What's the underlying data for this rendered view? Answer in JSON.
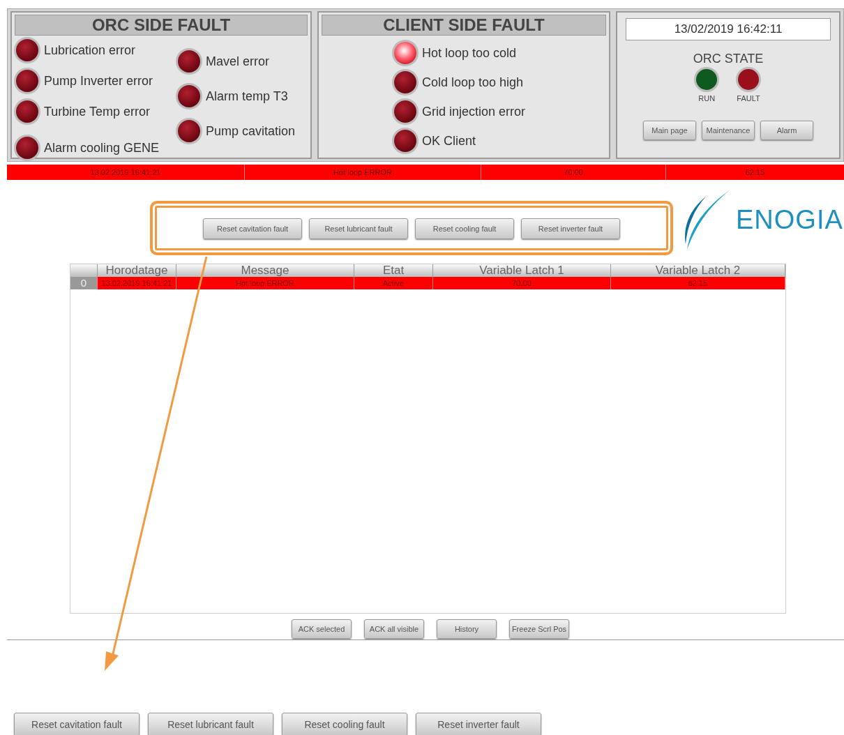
{
  "orc_side_fault": {
    "title": "ORC SIDE FAULT",
    "columns": [
      [
        {
          "label": "Lubrication error",
          "on": false
        },
        {
          "label": "Pump Inverter error",
          "on": false
        },
        {
          "label": "Turbine Temp error",
          "on": false
        },
        {
          "label": "Alarm cooling GENE",
          "on": false
        }
      ],
      [
        {
          "label": "Mavel error",
          "on": false
        },
        {
          "label": "Alarm temp T3",
          "on": false
        },
        {
          "label": "Pump cavitation",
          "on": false
        }
      ]
    ]
  },
  "client_side_fault": {
    "title": "CLIENT SIDE FAULT",
    "items": [
      {
        "label": "Hot loop too cold",
        "on": true
      },
      {
        "label": "Cold loop too high",
        "on": false
      },
      {
        "label": "Grid injection error",
        "on": false
      },
      {
        "label": "OK Client",
        "on": false
      }
    ]
  },
  "status_panel": {
    "datetime": "13/02/2019 16:42:11",
    "state_title": "ORC STATE",
    "states": [
      {
        "label": "RUN",
        "color": "#0e5a1e"
      },
      {
        "label": "FAULT",
        "color": "#9a0f1c"
      }
    ],
    "buttons": [
      "Main page",
      "Maintenance",
      "Alarm"
    ]
  },
  "alarm_banner": [
    "13.02.2019 16:41:21",
    "Hot loop ERROR",
    "70.00",
    "62.15"
  ],
  "reset_buttons": [
    "Reset cavitation fault",
    "Reset lubricant fault",
    "Reset cooling fault",
    "Reset inverter fault"
  ],
  "logo": "ENOGIA",
  "alarm_table": {
    "columns": [
      "Horodatage",
      "Message",
      "Etat",
      "Variable Latch 1",
      "Variable Latch 2"
    ],
    "rows": [
      {
        "index": "0",
        "cells": [
          "13.02.2019 16:41:21",
          "Hot loop ERROR",
          "Active",
          "70.00",
          "62.15"
        ]
      }
    ]
  },
  "table_buttons": [
    "ACK selected",
    "ACK all visible",
    "History",
    "Freeze Scrl Pos"
  ],
  "enlarged_reset_buttons": [
    "Reset cavitation fault",
    "Reset lubricant fault",
    "Reset cooling fault",
    "Reset inverter fault"
  ]
}
